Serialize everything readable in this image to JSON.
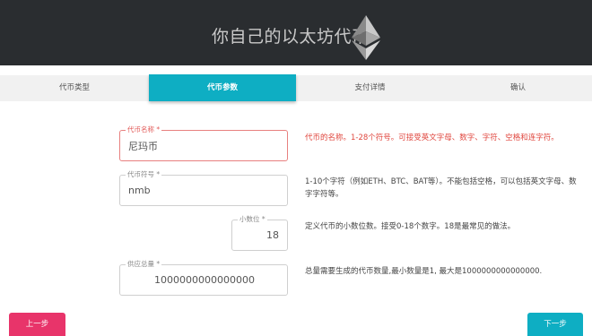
{
  "header": {
    "title": "你自己的以太坊代币",
    "logo_icon": "ethereum-logo-icon"
  },
  "steps": [
    {
      "label": "代币类型",
      "active": false
    },
    {
      "label": "代币参数",
      "active": true
    },
    {
      "label": "支付详情",
      "active": false
    },
    {
      "label": "确认",
      "active": false
    }
  ],
  "form": {
    "name": {
      "label": "代币名称 *",
      "value": "尼玛币",
      "help": "代币的名称。1-28个符号。可接受英文字母、数字、字符、空格和连字符。"
    },
    "symbol": {
      "label": "代币符号 *",
      "value": "nmb",
      "help_line1": "1-10个字符（例如ETH、BTC、BAT等）。不能包括空格，可以包括英文字母、数",
      "help_line2": "字字符等。"
    },
    "decimals": {
      "label": "小数位 *",
      "value": "18",
      "help": "定义代币的小数位数。接受0-18个数字。18是最常见的做法。"
    },
    "supply": {
      "label": "供应总量 *",
      "value": "1000000000000000",
      "help": "总量需要生成的代币数量,最小数量是1, 最大是1000000000000000."
    }
  },
  "buttons": {
    "prev": "上一步",
    "next": "下一步"
  },
  "colors": {
    "header_bg": "#2a2d30",
    "accent": "#0eaec3",
    "prev_button": "#e8346a",
    "error": "#e0473f"
  }
}
